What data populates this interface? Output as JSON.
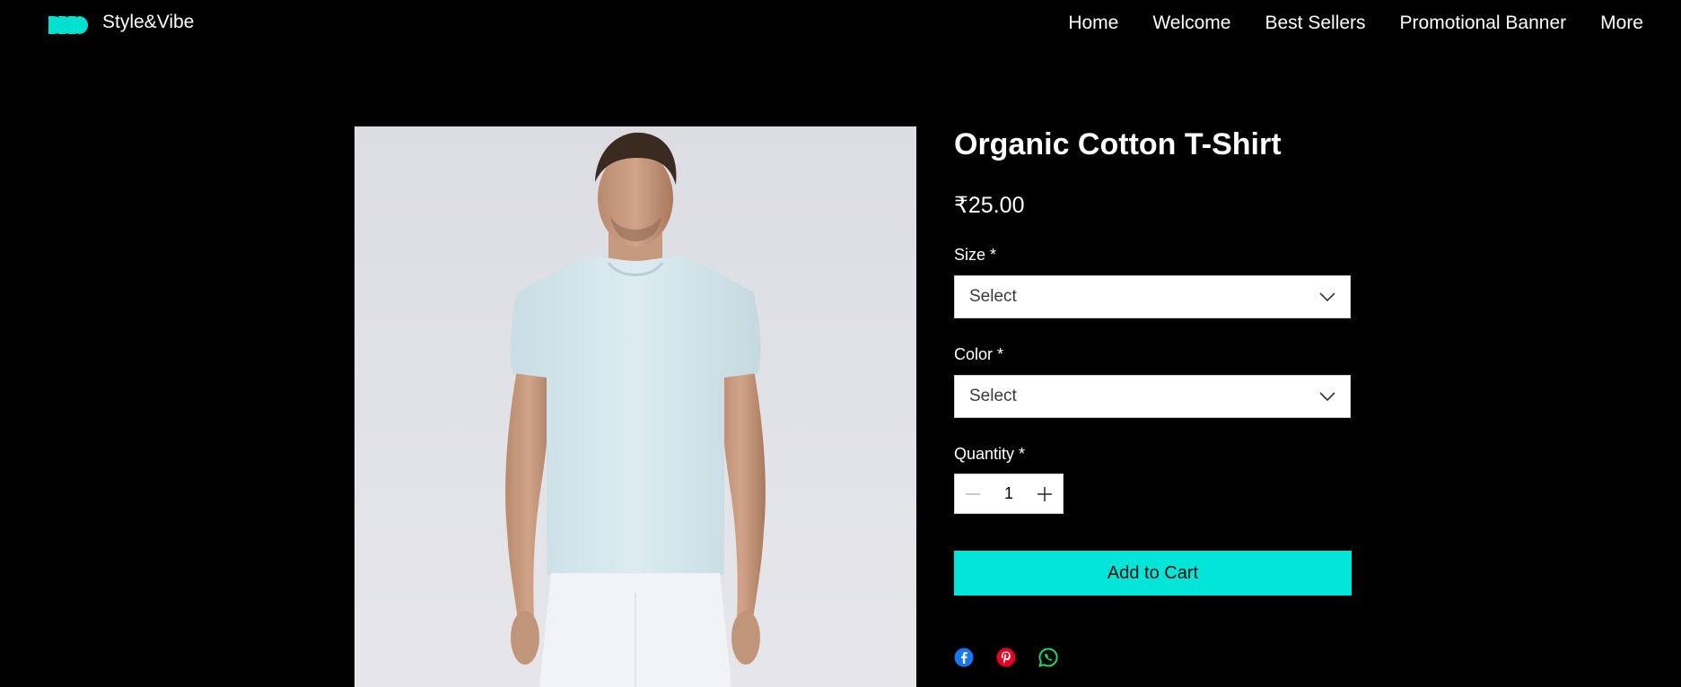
{
  "header": {
    "brand": "Style&Vibe",
    "logo_color": "#00e0d0",
    "nav": [
      "Home",
      "Welcome",
      "Best Sellers",
      "Promotional Banner",
      "More"
    ]
  },
  "product": {
    "title": "Organic Cotton T-Shirt",
    "price": "₹25.00",
    "image_icon": "product-photo",
    "size": {
      "label": "Size *",
      "value": "Select"
    },
    "color": {
      "label": "Color *",
      "value": "Select"
    },
    "quantity": {
      "label": "Quantity *",
      "value": "1"
    },
    "add_to_cart": "Add to Cart",
    "accent": "#00e5d8"
  },
  "share": {
    "icons": [
      "facebook-icon",
      "pinterest-icon",
      "whatsapp-icon"
    ],
    "colors": {
      "facebook": "#1877f2",
      "pinterest": "#e60023",
      "whatsapp": "#25d366"
    }
  }
}
